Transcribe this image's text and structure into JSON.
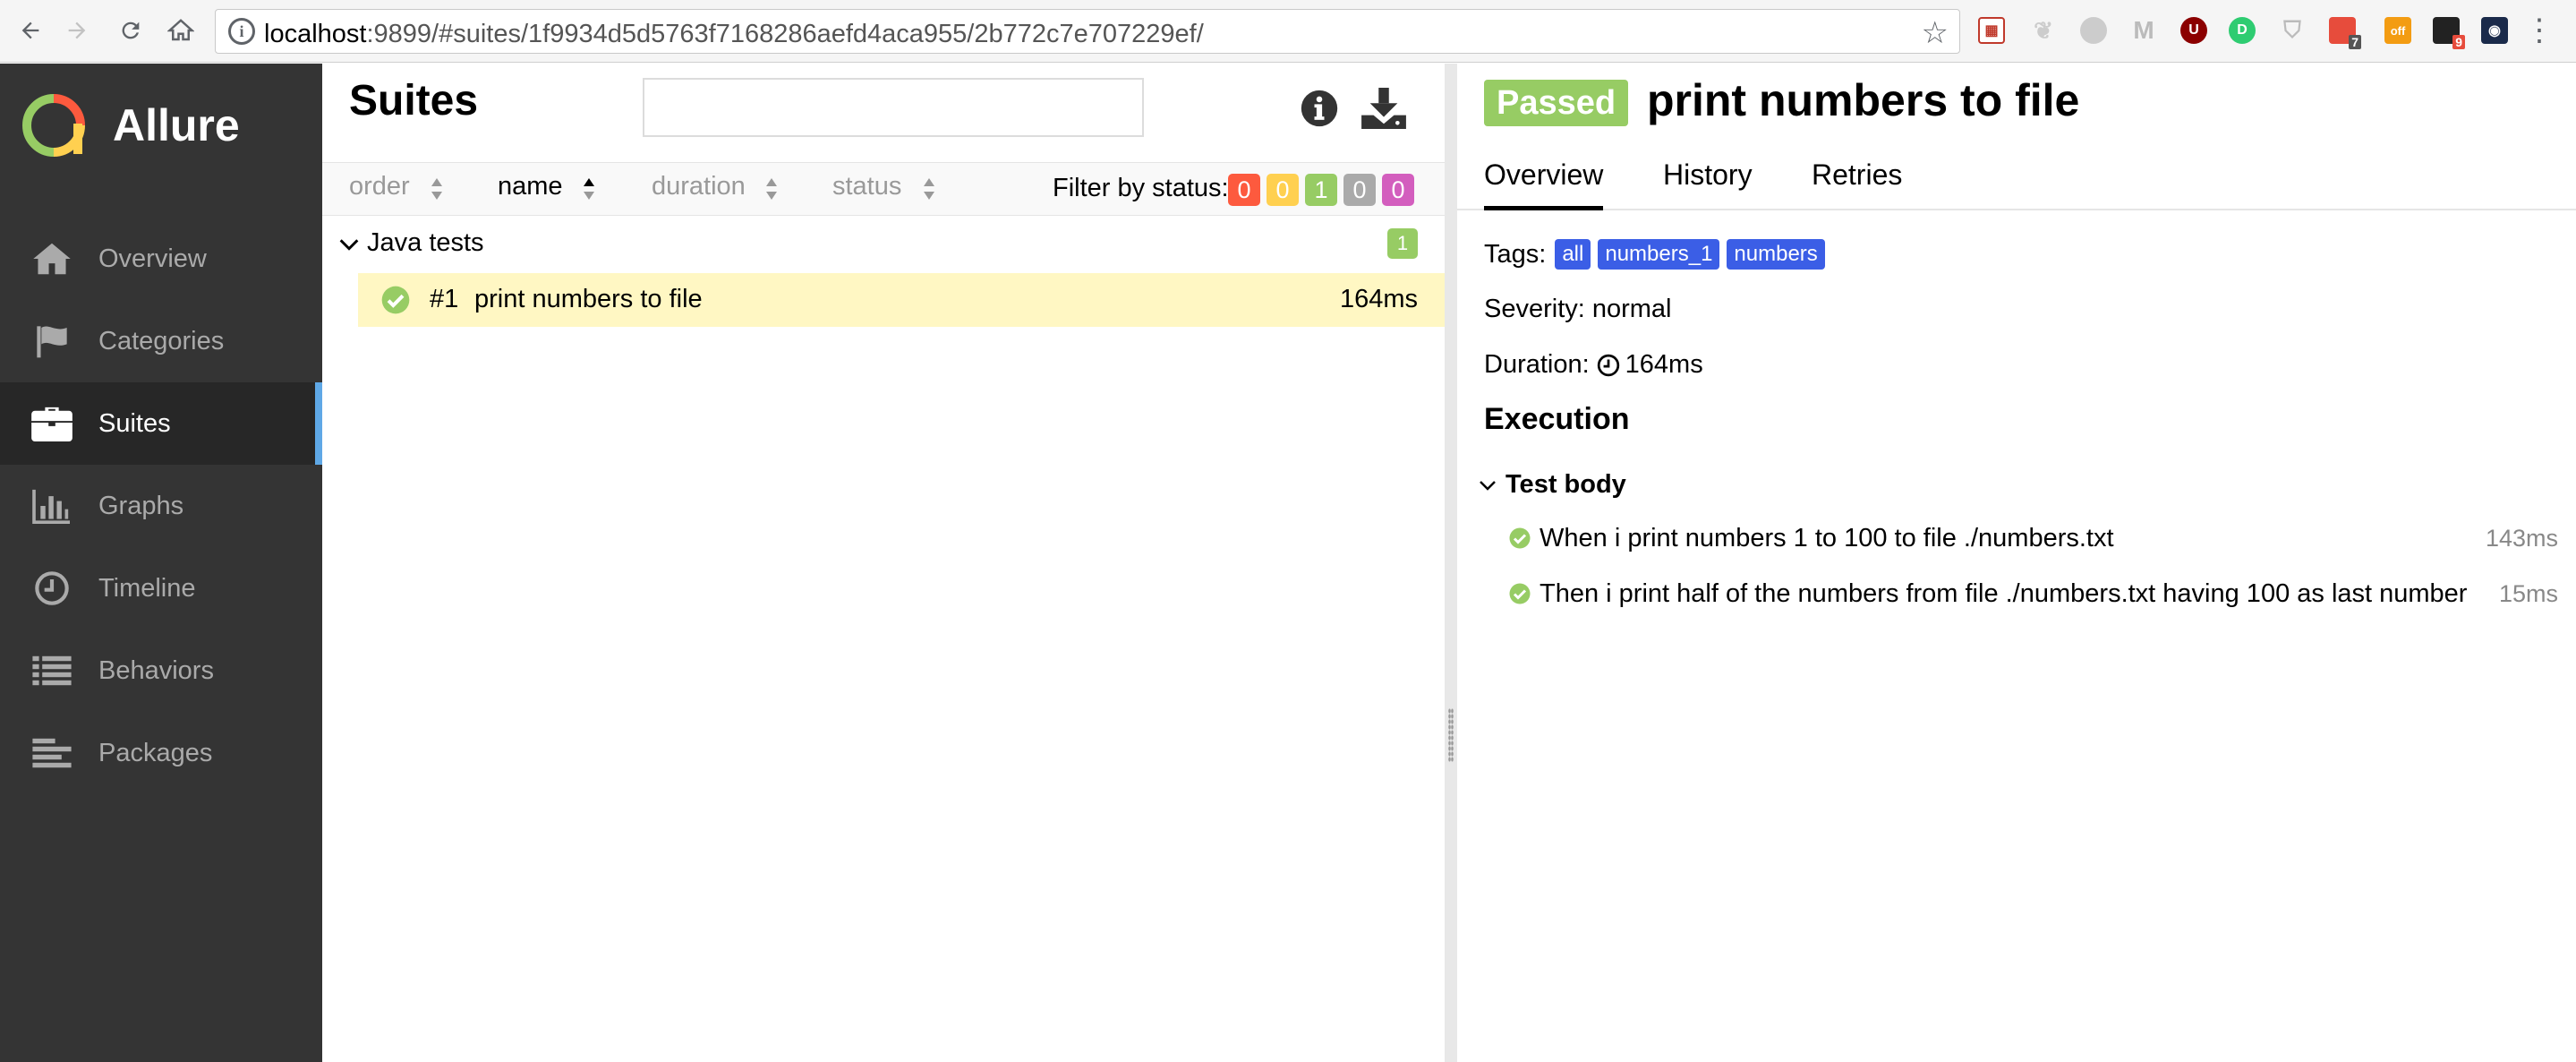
{
  "browser": {
    "url_host": "localhost",
    "url_path": ":9899/#suites/1f9934d5d5763f7168286aefd4aca955/2b772c7e707229ef/",
    "extension_badges": [
      "7",
      "off",
      "9"
    ]
  },
  "sidebar": {
    "brand": "Allure",
    "items": [
      {
        "label": "Overview",
        "icon": "home-icon"
      },
      {
        "label": "Categories",
        "icon": "flag-icon"
      },
      {
        "label": "Suites",
        "icon": "briefcase-icon",
        "active": true
      },
      {
        "label": "Graphs",
        "icon": "bar-chart-icon"
      },
      {
        "label": "Timeline",
        "icon": "clock-icon"
      },
      {
        "label": "Behaviors",
        "icon": "list-icon"
      },
      {
        "label": "Packages",
        "icon": "align-left-icon"
      }
    ]
  },
  "suites": {
    "title": "Suites",
    "search_value": "",
    "sort_columns": [
      {
        "label": "order",
        "active": false
      },
      {
        "label": "name",
        "active": true
      },
      {
        "label": "duration",
        "active": false
      },
      {
        "label": "status",
        "active": false
      }
    ],
    "filter_label": "Filter by status:",
    "filter_counts": [
      {
        "value": "0",
        "color": "#fd5a3e"
      },
      {
        "value": "0",
        "color": "#ffd050"
      },
      {
        "value": "1",
        "color": "#97cc64"
      },
      {
        "value": "0",
        "color": "#aaaaaa"
      },
      {
        "value": "0",
        "color": "#d35ebe"
      }
    ],
    "group": {
      "name": "Java tests",
      "count": "1"
    },
    "tests": [
      {
        "order": "#1",
        "name": "print numbers to file",
        "duration": "164ms",
        "status": "passed"
      }
    ]
  },
  "detail": {
    "status": "Passed",
    "title": "print numbers to file",
    "tabs": [
      "Overview",
      "History",
      "Retries"
    ],
    "tags_label": "Tags:",
    "tags": [
      "all",
      "numbers_1",
      "numbers"
    ],
    "severity_label": "Severity:",
    "severity": "normal",
    "duration_label": "Duration:",
    "duration": "164ms",
    "execution_title": "Execution",
    "test_body_title": "Test body",
    "steps": [
      {
        "name": "When i print numbers 1 to 100 to file ./numbers.txt",
        "duration": "143ms"
      },
      {
        "name": "Then i print half of the numbers from file ./numbers.txt having 100 as last number",
        "duration": "15ms"
      }
    ]
  },
  "colors": {
    "passed": "#97cc64",
    "sidebar_bg": "#343434",
    "active_marker": "#5fa8e6",
    "selected_row": "#fff7c3",
    "tag_blue": "#3b5ee6"
  }
}
